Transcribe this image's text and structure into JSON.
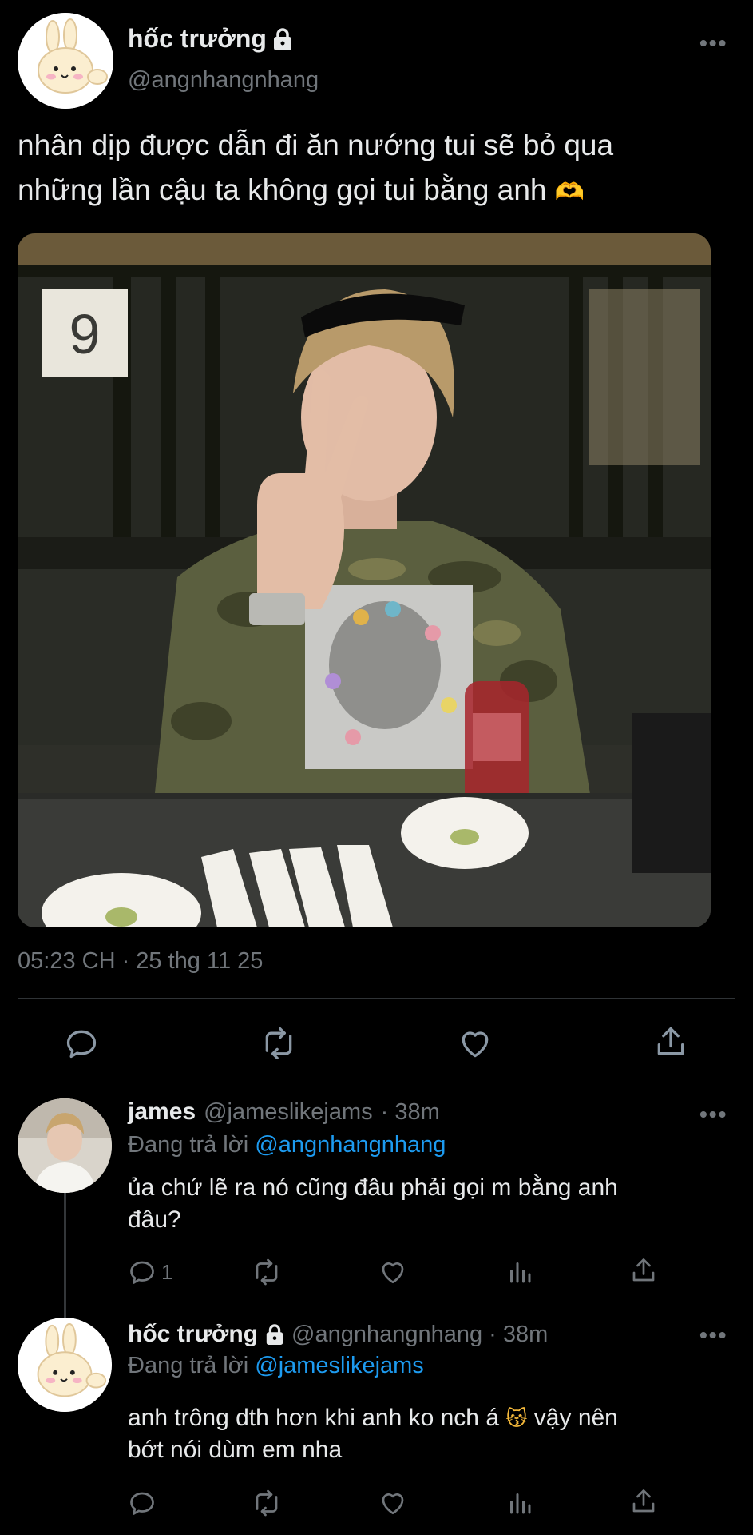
{
  "main_tweet": {
    "display_name": "hốc trưởng",
    "handle": "@angnhangnhang",
    "text_line1": "nhân dịp được dẫn đi ăn nướng tui sẽ bỏ qua",
    "text_line2": "những lần cậu ta không gọi tui bằng anh",
    "text_emoji": "🫶",
    "photo_sign_number": "9",
    "timestamp": "05:23 CH · 25 thg 11 25",
    "more_icon": "more-dots-icon"
  },
  "main_actions": [
    "reply-icon",
    "retweet-icon",
    "like-icon",
    "share-icon"
  ],
  "replies": [
    {
      "display_name": "james",
      "handle": "@jameslikejams",
      "time": "· 38m",
      "replying_prefix": "Đang trả lời",
      "replying_to": "@angnhangnhang",
      "text_line1": "ủa chứ lẽ ra nó cũng đâu phải gọi m bằng anh",
      "text_line2": "đâu?",
      "reply_count": "1"
    },
    {
      "display_name": "hốc trưởng",
      "handle": "@angnhangnhang",
      "time": "· 38m",
      "replying_prefix": "Đang trả lời",
      "replying_to": "@jameslikejams",
      "text_line1": "anh trông dth hơn khi anh ko nch á",
      "text_emoji": "😽",
      "text_line1b": " vậy nên",
      "text_line2": "bớt nói dùm em nha"
    }
  ],
  "colors": {
    "background": "#000000",
    "text": "#e7e9ea",
    "muted": "#71767b",
    "link": "#1d9bf0",
    "divider": "#2f3336"
  }
}
